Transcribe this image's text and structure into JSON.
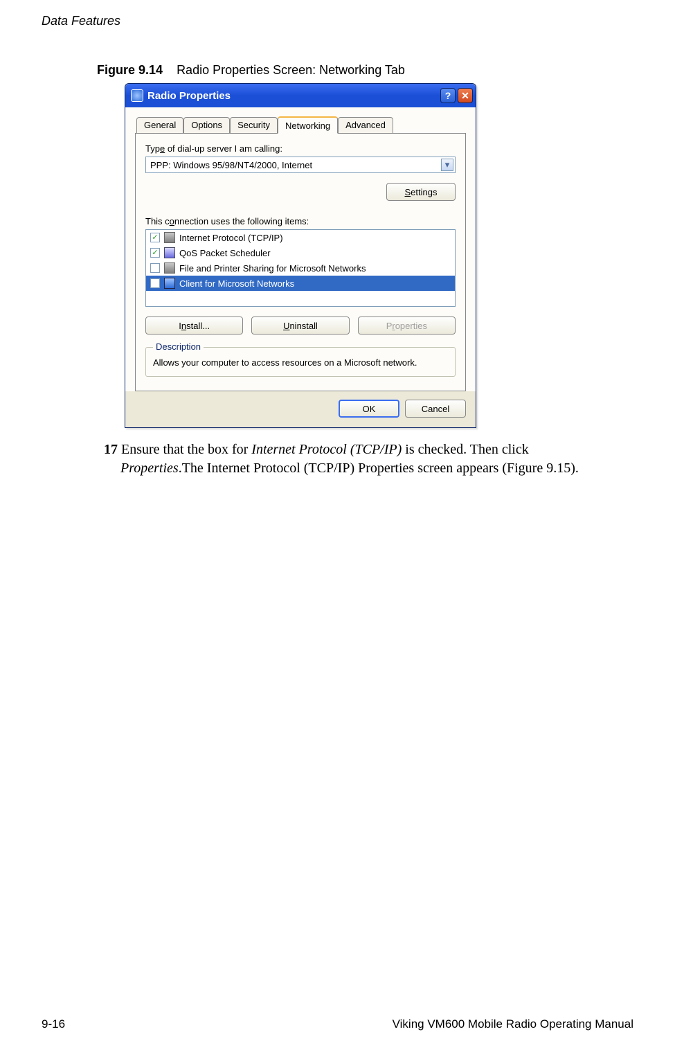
{
  "page_header": "Data Features",
  "figure": {
    "number": "Figure 9.14",
    "title": "Radio Properties Screen: Networking Tab"
  },
  "dialog": {
    "title": "Radio Properties",
    "help_glyph": "?",
    "close_glyph": "✕",
    "tabs": {
      "general": "General",
      "options": "Options",
      "security": "Security",
      "networking": "Networking",
      "advanced": "Advanced"
    },
    "server_label_pre": "Typ",
    "server_label_u": "e",
    "server_label_post": " of dial-up server I am calling:",
    "server_value": "PPP: Windows 95/98/NT4/2000, Internet",
    "dropdown_arrow": "▾",
    "settings_u": "S",
    "settings_post": "ettings",
    "uses_label": "This c",
    "uses_u": "o",
    "uses_post": "nnection uses the following items:",
    "items": {
      "tcpip": "Internet Protocol (TCP/IP)",
      "qos": "QoS Packet Scheduler",
      "fileprint": "File and Printer Sharing for Microsoft Networks",
      "client": "Client for Microsoft Networks"
    },
    "check_on": "✓",
    "check_off": "",
    "install_pre": "I",
    "install_u": "n",
    "install_post": "stall...",
    "uninstall_u": "U",
    "uninstall_post": "ninstall",
    "properties_pre": "P",
    "properties_u": "r",
    "properties_post": "operties",
    "group_title": "Description",
    "description": "Allows your computer to access resources on a Microsoft network.",
    "ok": "OK",
    "cancel": "Cancel"
  },
  "step": {
    "num": "17",
    "text_a": " Ensure that the box for ",
    "text_b": "Internet Protocol (TCP/IP)",
    "text_c": " is checked. Then click ",
    "text_d": "Properties",
    "text_e": ".The Internet Protocol (TCP/IP) Properties screen appears (Figure 9.15)."
  },
  "footer": {
    "left": "9-16",
    "right": "Viking VM600 Mobile Radio Operating Manual"
  }
}
